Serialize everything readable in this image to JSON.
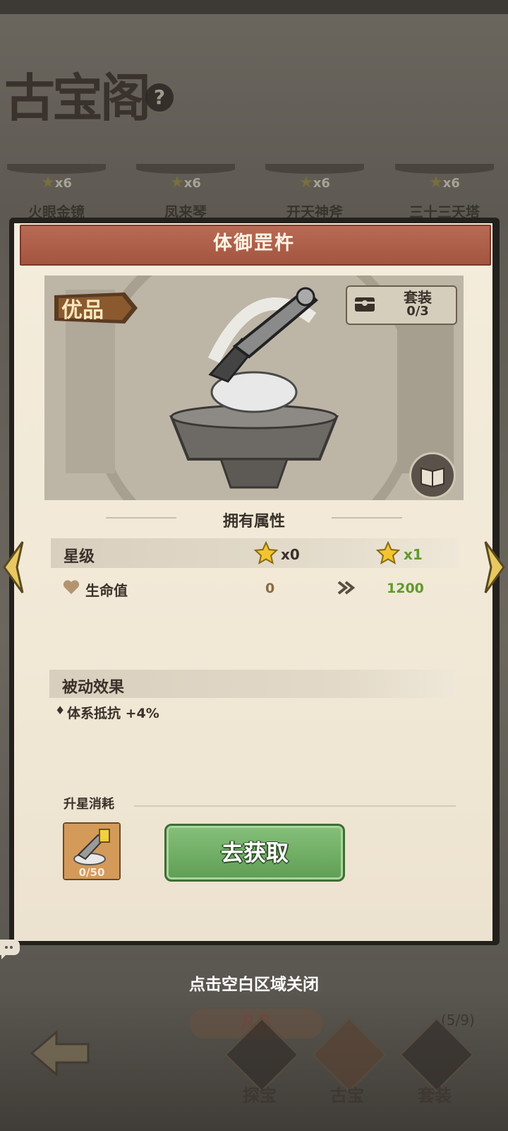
{
  "background": {
    "header_title": "古宝阁",
    "help_icon": "question-icon",
    "treasure_tabs": [
      {
        "stars": "x6",
        "name": "火眼金镜"
      },
      {
        "stars": "x6",
        "name": "凤来琴"
      },
      {
        "stars": "x6",
        "name": "开天神斧"
      },
      {
        "stars": "x6",
        "name": "三十三天塔"
      }
    ],
    "banner_label": "凡品",
    "count": "(5/9)",
    "nav": [
      {
        "label": "探宝"
      },
      {
        "label": "古宝"
      },
      {
        "label": "套装"
      }
    ]
  },
  "modal": {
    "title": "体御罡杵",
    "quality": "优品",
    "set": {
      "label": "套装",
      "count": "0/3"
    },
    "attributes_title": "拥有属性",
    "star_row": {
      "label": "星级",
      "current": "x0",
      "next": "x1"
    },
    "hp_row": {
      "label": "生命值",
      "current": "0",
      "next": "1200"
    },
    "passive": {
      "title": "被动效果",
      "bullet": "♦",
      "effect": "体系抵抗 +4%"
    },
    "cost": {
      "label": "升星消耗",
      "item_count": "0/50"
    },
    "obtain_button": "去获取"
  },
  "close_hint": "点击空白区域关闭",
  "colors": {
    "title_bar": "#a4553f",
    "accent_green": "#5f9a2e",
    "panel_bg": "#f4ecdc",
    "star_gold": "#f2c530"
  }
}
